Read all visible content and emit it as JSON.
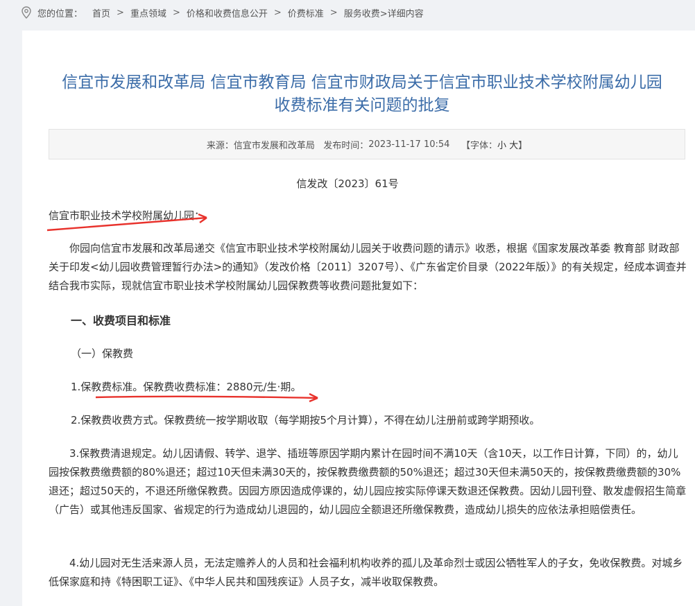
{
  "breadcrumb": {
    "prefix": "您的位置：",
    "items": [
      "首页",
      "重点领域",
      "价格和收费信息公开",
      "价费标准",
      "服务收费"
    ],
    "tail": ">详细内容"
  },
  "article": {
    "title_line1": "信宜市发展和改革局 信宜市教育局 信宜市财政局关于信宜市职业技术学校附属幼儿园",
    "title_line2": "收费标准有关问题的批复",
    "meta": {
      "source_label": "来源：",
      "source": "信宜市发展和改革局",
      "time_label": "发布时间：",
      "time": "2023-11-17 10:54",
      "font_label": "【字体：",
      "font_small": "小",
      "font_large": "大",
      "font_close": "】"
    },
    "doc_number": "信发改〔2023〕61号",
    "salutation": "信宜市职业技术学校附属幼儿园：",
    "intro": "你园向信宜市发展和改革局递交《信宜市职业技术学校附属幼儿园关于收费问题的请示》收悉，根据《国家发展改革委 教育部 财政部关于印发<幼儿园收费管理暂行办法>的通知》（发改价格〔2011〕3207号）、《广东省定价目录（2022年版）》的有关规定，经成本调查并结合我市实际，现就信宜市职业技术学校附属幼儿园保教费等收费问题批复如下：",
    "section1": "一、收费项目和标准",
    "sub1": "（一）保教费",
    "item1": "1.保教费标准。保教费收费标准：2880元/生·期。",
    "item2": "2.保教费收费方式。保教费统一按学期收取（每学期按5个月计算），不得在幼儿注册前或跨学期预收。",
    "item3": "3.保教费清退规定。幼儿因请假、转学、退学、插班等原因学期内累计在园时间不满10天（含10天，以工作日计算，下同）的，幼儿园按保教费缴费额的80%退还；超过10天但未满30天的，按保教费缴费额的50%退还；超过30天但未满50天的，按保教费缴费额的30%退还；超过50天的，不退还所缴保教费。因园方原因造成停课的，幼儿园应按实际停课天数退还保教费。因幼儿园刊登、散发虚假招生简章（广告）或其他违反国家、省规定的行为造成幼儿退园的，幼儿园应全额退还所缴保教费，造成幼儿损失的应依法承担赔偿责任。",
    "item4": "4.幼儿园对无生活来源人员，无法定赡养人的人员和社会福利机构收养的孤儿及革命烈士或因公牺牲军人的子女，免收保教费。对城乡低保家庭和持《特困职工证》、《中华人民共和国残疾证》人员子女，减半收取保教费。"
  },
  "colors": {
    "title": "#3b6ca8",
    "arrow": "#e8322c",
    "background": "#f0f2f5"
  }
}
